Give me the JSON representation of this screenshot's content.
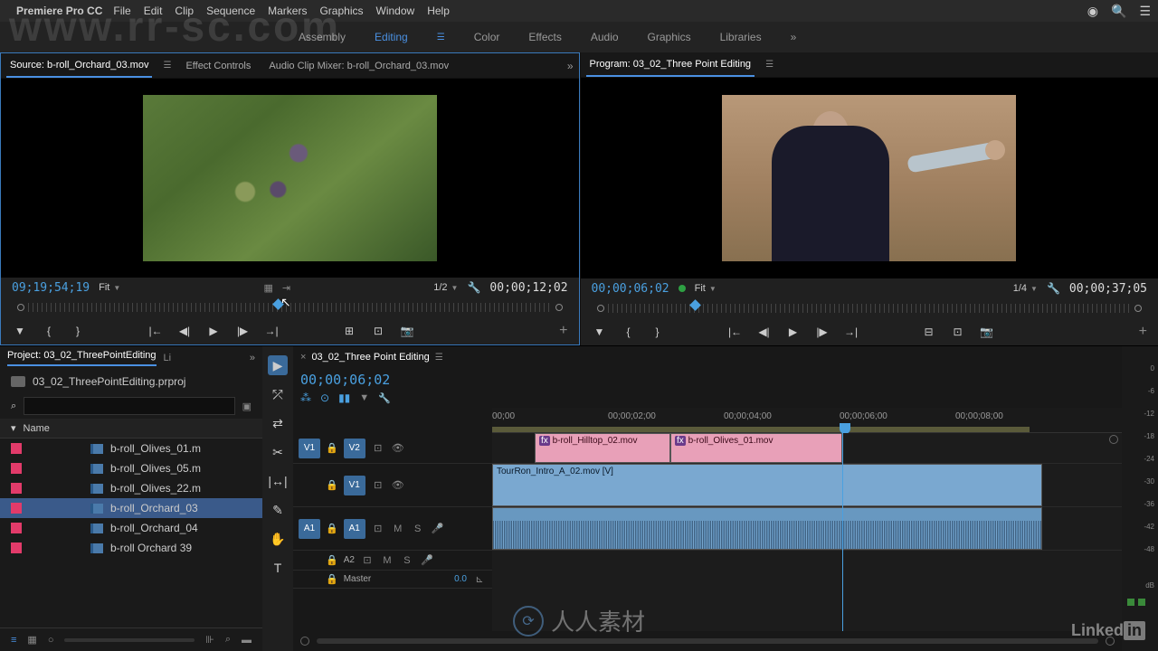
{
  "menubar": {
    "app": "Premiere Pro CC",
    "items": [
      "File",
      "Edit",
      "Clip",
      "Sequence",
      "Markers",
      "Graphics",
      "Window",
      "Help"
    ]
  },
  "workspaces": {
    "items": [
      "Assembly",
      "Editing",
      "Color",
      "Effects",
      "Audio",
      "Graphics",
      "Libraries"
    ],
    "active": "Editing"
  },
  "source": {
    "tabs": {
      "source": "Source: b-roll_Orchard_03.mov",
      "effect": "Effect Controls",
      "mixer": "Audio Clip Mixer: b-roll_Orchard_03.mov"
    },
    "tc_in": "09;19;54;19",
    "fit": "Fit",
    "res": "1/2",
    "tc_out": "00;00;12;02"
  },
  "program": {
    "tab": "Program: 03_02_Three Point Editing",
    "tc_in": "00;00;06;02",
    "fit": "Fit",
    "res": "1/4",
    "tc_out": "00;00;37;05"
  },
  "project": {
    "tab": "Project: 03_02_ThreePointEditing",
    "tab2": "Li",
    "file": "03_02_ThreePointEditing.prproj",
    "search_ph": "",
    "name_col": "Name",
    "bins": [
      {
        "name": "b-roll_Olives_01.m",
        "sel": false
      },
      {
        "name": "b-roll_Olives_05.m",
        "sel": false
      },
      {
        "name": "b-roll_Olives_22.m",
        "sel": false
      },
      {
        "name": "b-roll_Orchard_03",
        "sel": true
      },
      {
        "name": "b-roll_Orchard_04",
        "sel": false
      },
      {
        "name": "b-roll Orchard 39",
        "sel": false
      }
    ],
    "search_icon": "⌕"
  },
  "timeline": {
    "tab": "03_02_Three Point Editing",
    "tc": "00;00;06;02",
    "ruler": [
      "00;00",
      "00;00;02;00",
      "00;00;04;00",
      "00;00;06;00",
      "00;00;08;00"
    ],
    "tracks": {
      "v2": "V2",
      "v1": "V1",
      "v1_src": "V1",
      "a1_src": "A1",
      "a1": "A1",
      "a2": "A2",
      "master": "Master",
      "master_val": "0.0",
      "mute": "M",
      "solo": "S"
    },
    "clips": {
      "hilltop": "b-roll_Hilltop_02.mov",
      "olives": "b-roll_Olives_01.mov",
      "intro": "TourRon_Intro_A_02.mov [V]"
    }
  },
  "meters": {
    "scale": [
      "0",
      "-6",
      "-12",
      "-18",
      "-24",
      "-30",
      "-36",
      "-42",
      "-48",
      "dB"
    ]
  },
  "branding": {
    "wm": "www.rr-sc.com",
    "rrs": "人人素材",
    "linkedin": "Linked",
    "in": "in"
  }
}
